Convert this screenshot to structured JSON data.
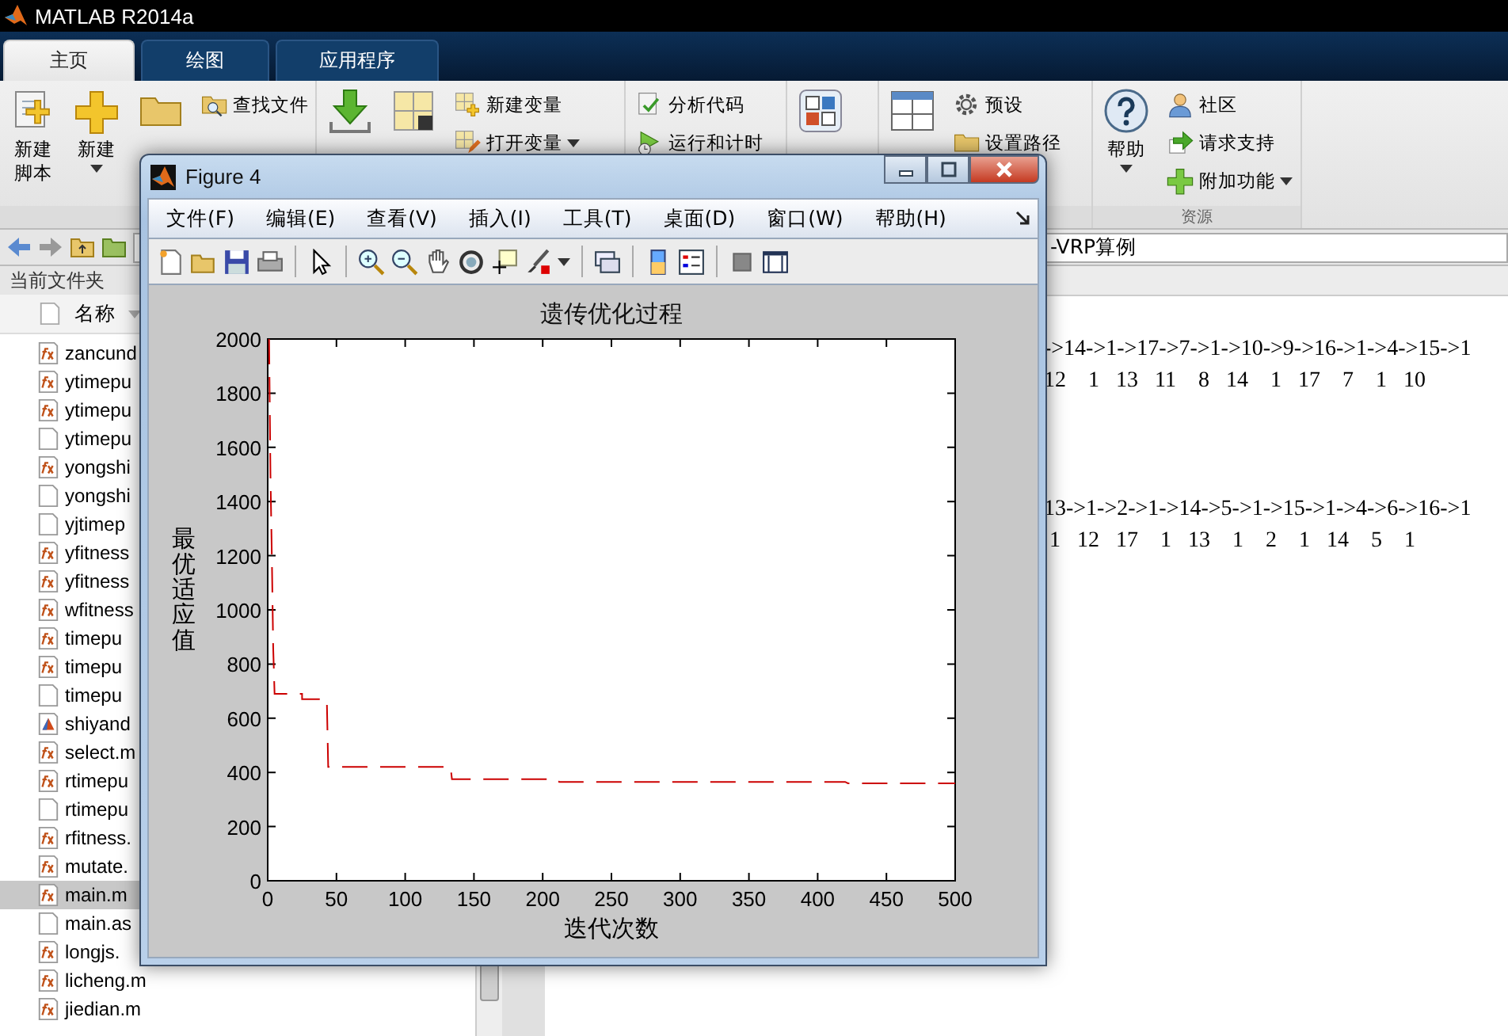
{
  "window": {
    "title": "MATLAB R2014a"
  },
  "tabs": [
    {
      "label": "主页",
      "selected": true
    },
    {
      "label": "绘图",
      "selected": false
    },
    {
      "label": "应用程序",
      "selected": false
    }
  ],
  "ribbon": {
    "sections": [
      {
        "groups": [
          {
            "kind": "large",
            "label": "新建脚本",
            "dropdown": false
          },
          {
            "kind": "large",
            "label": "新建",
            "dropdown": true
          },
          {
            "kind": "icon"
          },
          {
            "kind": "stack",
            "items": [
              {
                "label": "查找文件",
                "dropdown": false
              }
            ]
          }
        ]
      },
      {
        "groups": [
          {
            "kind": "icon"
          },
          {
            "kind": "icon"
          },
          {
            "kind": "stack",
            "items": [
              {
                "label": "新建变量",
                "dropdown": false
              },
              {
                "label": "打开变量",
                "dropdown": true
              }
            ]
          }
        ]
      },
      {
        "groups": [
          {
            "kind": "stack",
            "items": [
              {
                "label": "分析代码",
                "dropdown": false
              },
              {
                "label": "运行和计时",
                "dropdown": false
              }
            ]
          }
        ]
      },
      {
        "groups": [
          {
            "kind": "icon"
          }
        ]
      },
      {
        "groups": [
          {
            "kind": "icon"
          },
          {
            "kind": "stack",
            "items": [
              {
                "label": "预设",
                "dropdown": false
              },
              {
                "label": "设置路径",
                "dropdown": false
              }
            ]
          }
        ]
      },
      {
        "label": "资源",
        "groups": [
          {
            "kind": "large",
            "label": "帮助",
            "dropdown": true
          },
          {
            "kind": "stack",
            "items": [
              {
                "label": "社区",
                "dropdown": false
              },
              {
                "label": "请求支持",
                "dropdown": false
              },
              {
                "label": "附加功能",
                "dropdown": true
              }
            ]
          }
        ]
      }
    ]
  },
  "address_bar": {
    "path": "-VRP算例"
  },
  "current_folder": {
    "title": "当前文件夹",
    "column": "名称",
    "files": [
      {
        "name": "zancund",
        "kind": "function",
        "selected": false
      },
      {
        "name": "ytimepu",
        "kind": "function",
        "selected": false
      },
      {
        "name": "ytimepu",
        "kind": "function",
        "selected": false
      },
      {
        "name": "ytimepu",
        "kind": "file",
        "selected": false
      },
      {
        "name": "yongshi",
        "kind": "function",
        "selected": false
      },
      {
        "name": "yongshi",
        "kind": "file",
        "selected": false
      },
      {
        "name": "yjtimep",
        "kind": "file",
        "selected": false
      },
      {
        "name": "yfitness",
        "kind": "function",
        "selected": false
      },
      {
        "name": "yfitness",
        "kind": "function",
        "selected": false
      },
      {
        "name": "wfitness",
        "kind": "function",
        "selected": false
      },
      {
        "name": "timepu",
        "kind": "function",
        "selected": false
      },
      {
        "name": "timepu",
        "kind": "function",
        "selected": false
      },
      {
        "name": "timepu",
        "kind": "file",
        "selected": false
      },
      {
        "name": "shiyand",
        "kind": "figure",
        "selected": false
      },
      {
        "name": "select.m",
        "kind": "function",
        "selected": false
      },
      {
        "name": "rtimepu",
        "kind": "function",
        "selected": false
      },
      {
        "name": "rtimepu",
        "kind": "file",
        "selected": false
      },
      {
        "name": "rfitness.",
        "kind": "function",
        "selected": false
      },
      {
        "name": "mutate.",
        "kind": "function",
        "selected": false
      },
      {
        "name": "main.m",
        "kind": "function",
        "selected": true
      },
      {
        "name": "main.as",
        "kind": "file",
        "selected": false
      },
      {
        "name": "longjs.",
        "kind": "function",
        "selected": false
      },
      {
        "name": "licheng.m",
        "kind": "function",
        "selected": false
      },
      {
        "name": "jiedian.m",
        "kind": "function",
        "selected": false
      }
    ]
  },
  "command_window": {
    "outputs": [
      {
        "route": "->14->1->17->7->1->10->9->16->1->4->15->1",
        "sequence": "12    1   13   11    8   14    1   17    7    1   10"
      },
      {
        "route": "13->1->2->1->14->5->1->15->1->4->6->16->1",
        "sequence": " 1   12   17    1   13    1    2    1   14    5    1"
      }
    ]
  },
  "figure": {
    "title": "Figure 4",
    "menu": [
      "文件(F)",
      "编辑(E)",
      "查看(V)",
      "插入(I)",
      "工具(T)",
      "桌面(D)",
      "窗口(W)",
      "帮助(H)"
    ],
    "chart_data": {
      "type": "line",
      "title": "遗传优化过程",
      "xlabel": "迭代次数",
      "ylabel": "最优适应值",
      "x": [
        1,
        2,
        3,
        4,
        5,
        25,
        25,
        43,
        44,
        133,
        134,
        210,
        212,
        420,
        422,
        500
      ],
      "series": [
        {
          "color": "#cc0000",
          "line_style": "dashed",
          "values": [
            2000,
            1500,
            1200,
            860,
            690,
            690,
            670,
            670,
            420,
            420,
            375,
            375,
            365,
            365,
            360,
            360
          ]
        }
      ],
      "xlim": [
        0,
        500
      ],
      "ylim": [
        0,
        2000
      ],
      "xticks": [
        0,
        50,
        100,
        150,
        200,
        250,
        300,
        350,
        400,
        450,
        500
      ],
      "yticks": [
        0,
        200,
        400,
        600,
        800,
        1000,
        1200,
        1400,
        1600,
        1800,
        2000
      ]
    }
  }
}
